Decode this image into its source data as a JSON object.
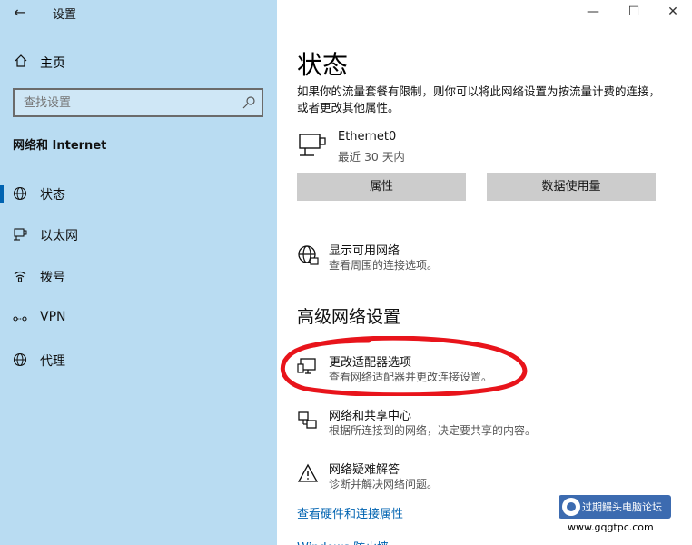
{
  "window": {
    "title": "设置",
    "back_glyph": "←",
    "minimize_glyph": "—",
    "maximize_glyph": "☐",
    "close_glyph": "✕"
  },
  "sidebar": {
    "home_label": "主页",
    "search_placeholder": "查找设置",
    "section_title": "网络和 Internet",
    "items": [
      {
        "label": "状态",
        "icon": "globe-icon",
        "active": true
      },
      {
        "label": "以太网",
        "icon": "ethernet-icon",
        "active": false
      },
      {
        "label": "拨号",
        "icon": "dialup-icon",
        "active": false
      },
      {
        "label": "VPN",
        "icon": "vpn-icon",
        "active": false
      },
      {
        "label": "代理",
        "icon": "globe-icon",
        "active": false
      }
    ]
  },
  "main": {
    "title": "状态",
    "description": "如果你的流量套餐有限制，则你可以将此网络设置为按流量计费的连接，或者更改其他属性。",
    "connection": {
      "name": "Ethernet0",
      "usage": "最近 30 天内"
    },
    "buttons": {
      "properties": "属性",
      "data_usage": "数据使用量"
    },
    "show_networks": {
      "title": "显示可用网络",
      "subtitle": "查看周围的连接选项。"
    },
    "advanced_heading": "高级网络设置",
    "adapter_options": {
      "title": "更改适配器选项",
      "subtitle": "查看网络适配器并更改连接设置。"
    },
    "sharing_center": {
      "title": "网络和共享中心",
      "subtitle": "根据所连接到的网络，决定要共享的内容。"
    },
    "troubleshoot": {
      "title": "网络疑难解答",
      "subtitle": "诊断并解决网络问题。"
    },
    "link_hardware": "查看硬件和连接属性",
    "link_firewall": "Windows 防火墙"
  },
  "annotation_color": "#e8141b",
  "accent_color": "#0063b1",
  "sidebar_color": "#b9dcf2",
  "watermark": {
    "text": "过期鳗头电脑论坛",
    "url": "www.gqgtpc.com"
  }
}
